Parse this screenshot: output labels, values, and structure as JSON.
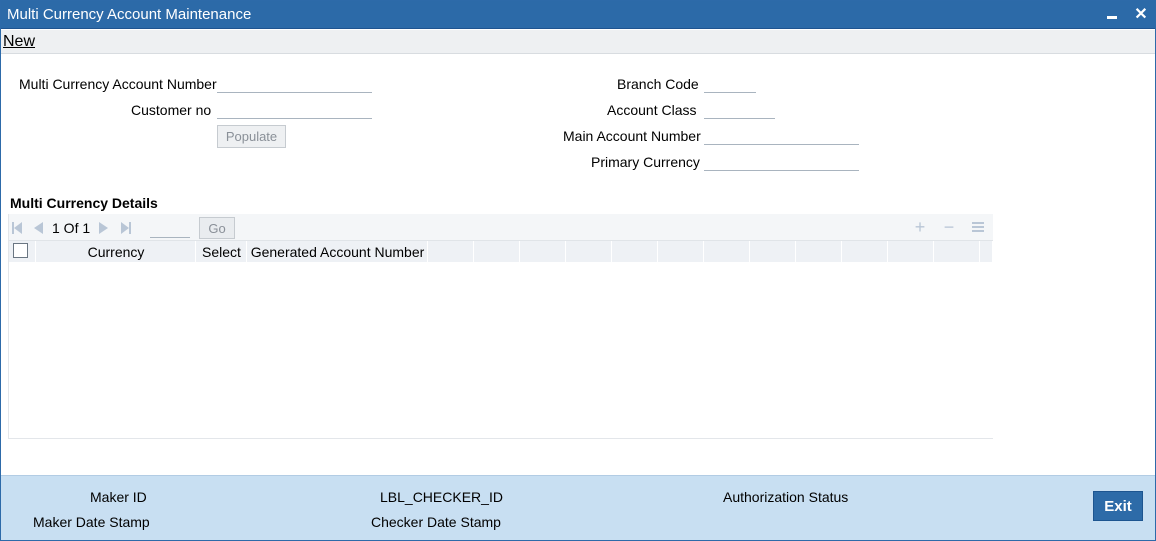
{
  "window": {
    "title": "Multi Currency Account Maintenance",
    "minimize_icon": "minimize-icon",
    "close_icon": "close-icon"
  },
  "menu": {
    "new_label": "New"
  },
  "form": {
    "multi_currency_account_number": {
      "label": "Multi Currency Account Number",
      "value": ""
    },
    "customer_no": {
      "label": "Customer no",
      "value": ""
    },
    "populate_button": "Populate",
    "branch_code": {
      "label": "Branch Code",
      "value": ""
    },
    "account_class": {
      "label": "Account Class",
      "value": ""
    },
    "main_account_number": {
      "label": "Main Account Number",
      "value": ""
    },
    "primary_currency": {
      "label": "Primary Currency",
      "value": ""
    }
  },
  "details": {
    "section_title": "Multi Currency Details",
    "pagination": {
      "text": "1 Of 1",
      "go_label": "Go",
      "page_value": ""
    },
    "columns": [
      "Currency",
      "Select",
      "Generated Account Number"
    ],
    "rows": []
  },
  "footer": {
    "maker_id": "Maker ID",
    "checker_id": "LBL_CHECKER_ID",
    "authorization_status": "Authorization Status",
    "maker_date_stamp": "Maker Date Stamp",
    "checker_date_stamp": "Checker Date Stamp",
    "exit_label": "Exit"
  },
  "colors": {
    "titlebar": "#2c6aa8",
    "footer": "#c8dff2",
    "exit_button": "#2d6ba8"
  }
}
